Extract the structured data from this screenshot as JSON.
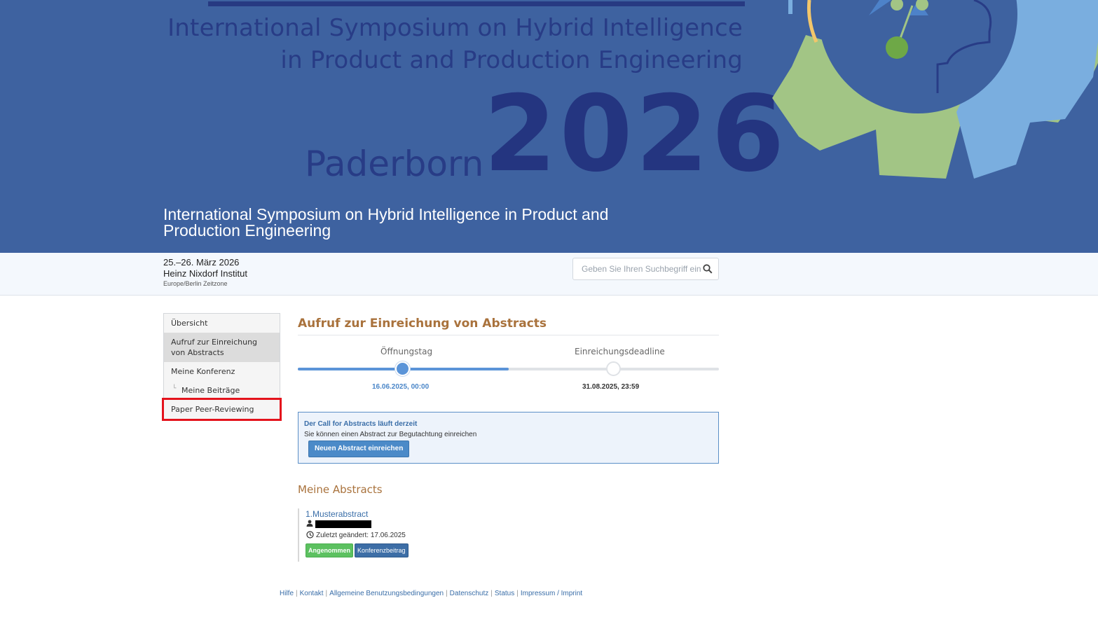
{
  "banner": {
    "line1": "International Symposium on Hybrid Intelligence",
    "line2": "in Product and Production Engineering",
    "city": "Paderborn",
    "year": "2026",
    "colors": {
      "background": "#3e62a0",
      "dark_blue": "#283c86",
      "gear_green": "#a2c585",
      "gear_light_blue": "#7aaedf",
      "accent_yellow": "#f2c66b"
    }
  },
  "conference": {
    "title": "International Symposium on Hybrid Intelligence in Product and Production Engineering",
    "dates": "25.–26. März 2026",
    "venue": "Heinz Nixdorf Institut",
    "timezone": "Europe/Berlin Zeitzone"
  },
  "search": {
    "placeholder": "Geben Sie Ihren Suchbegriff ein",
    "icon": "search-icon"
  },
  "sidebar": {
    "items": [
      {
        "label": "Übersicht"
      },
      {
        "label": "Aufruf zur Einreichung von Abstracts"
      },
      {
        "label": "Meine Konferenz"
      },
      {
        "label": "Meine Beiträge"
      },
      {
        "label": "Paper Peer-Reviewing"
      }
    ]
  },
  "main": {
    "title": "Aufruf zur Einreichung von Abstracts",
    "timeline": {
      "start_label": "Öffnungstag",
      "start_date": "16.06.2025, 00:00",
      "end_label": "Einreichungsdeadline",
      "end_date": "31.08.2025, 23:59",
      "progress_fraction": 0.5,
      "colors": {
        "active": "#5b94d8",
        "inactive": "#dfe2e6"
      }
    },
    "cfa": {
      "title": "Der Call for Abstracts läuft derzeit",
      "text": "Sie können einen Abstract zur Begutachtung einreichen",
      "button": "Neuen Abstract einreichen"
    },
    "abstracts": {
      "heading": "Meine Abstracts",
      "items": [
        {
          "number": "1.",
          "title": "Musterabstract",
          "modified": "Zuletzt geändert: 17.06.2025",
          "status": "Angenommen",
          "type": "Konferenzbeitrag"
        }
      ]
    }
  },
  "footer": {
    "links": [
      "Hilfe",
      "Kontakt",
      "Allgemeine Benutzungsbedingungen",
      "Datenschutz",
      "Status",
      "Impressum / Imprint"
    ]
  }
}
